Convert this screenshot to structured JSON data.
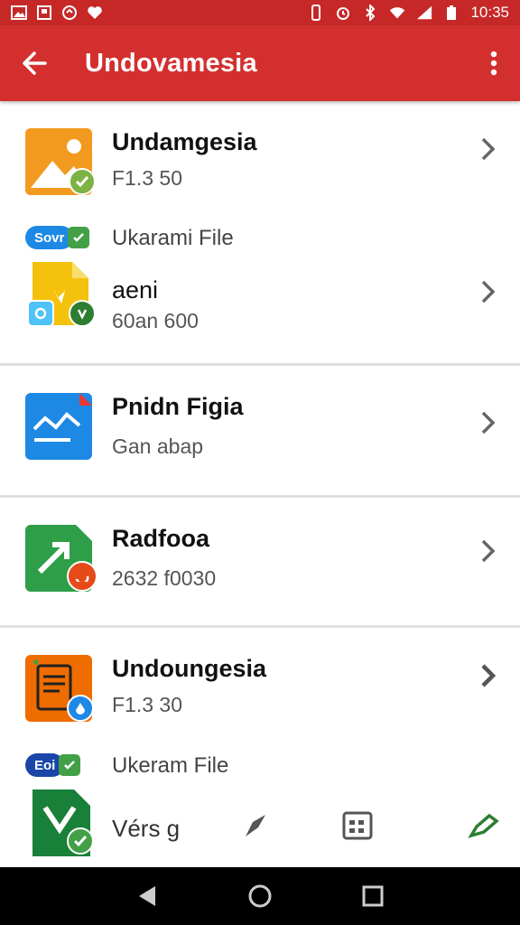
{
  "status_bar": {
    "time": "10:35",
    "colors": {
      "background": "#c62828"
    }
  },
  "app_bar": {
    "title": "Undovamesia",
    "colors": {
      "background": "#d32f2f"
    }
  },
  "list": {
    "items": [
      {
        "title": "Undamgesia",
        "subtitle": "F1.3 50",
        "icon": "image-file-icon"
      },
      {
        "tag": "Sovr",
        "tag_label": "Ukarami File"
      },
      {
        "title": "aeni",
        "subtitle": "60an 600",
        "icon": "document-file-icon"
      },
      {
        "title": "Pnidn Figia",
        "subtitle": "Gan abap",
        "icon": "chart-file-icon"
      },
      {
        "title": "Radfooa",
        "subtitle": "2632 f0030",
        "icon": "spreadsheet-file-icon"
      },
      {
        "title": "Undoungesia",
        "subtitle": "F1.3 30",
        "icon": "text-file-icon"
      },
      {
        "tag": "Eoi",
        "tag_label": "Ukeram File"
      }
    ]
  },
  "bottom_toolbar": {
    "label": "Vérs g"
  }
}
